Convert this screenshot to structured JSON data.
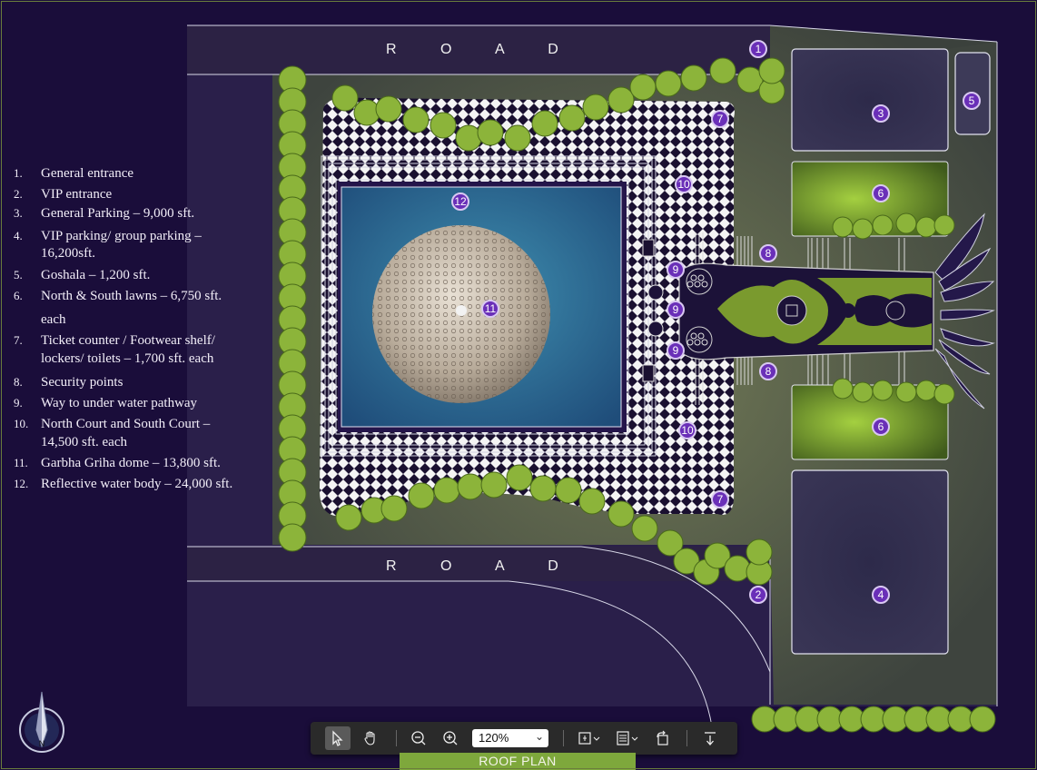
{
  "roads": {
    "top_label": "R O A D",
    "bottom_label": "R O A D"
  },
  "legend": [
    {
      "num": "1.",
      "text": "General entrance"
    },
    {
      "num": "2.",
      "text": "VIP entrance"
    },
    {
      "num": "3.",
      "text": "General Parking – 9,000 sft."
    },
    {
      "num": "4.",
      "text": "VIP parking/ group parking –",
      "text2": "16,200sft."
    },
    {
      "num": "5.",
      "text": "Goshala – 1,200 sft."
    },
    {
      "num": "6.",
      "text": "North & South lawns – 6,750 sft.",
      "text2": "each"
    },
    {
      "num": "7.",
      "text": "Ticket counter / Footwear shelf/",
      "text2": "lockers/ toilets – 1,700 sft. each"
    },
    {
      "num": "8.",
      "text": "Security points"
    },
    {
      "num": "9.",
      "text": "Way to under water pathway"
    },
    {
      "num": "10.",
      "text": "North Court and South Court –",
      "text2": "14,500 sft. each"
    },
    {
      "num": "11.",
      "text": "Garbha Griha dome – 13,800 sft."
    },
    {
      "num": "12.",
      "text": "Reflective water body – 24,000 sft."
    }
  ],
  "markers": {
    "m1": "1",
    "m2": "2",
    "m3": "3",
    "m4": "4",
    "m5": "5",
    "m6a": "6",
    "m6b": "6",
    "m7a": "7",
    "m7b": "7",
    "m8a": "8",
    "m8b": "8",
    "m9a": "9",
    "m9b": "9",
    "m9c": "9",
    "m10a": "10",
    "m10b": "10",
    "m11": "11",
    "m12": "12"
  },
  "compass": {
    "label": "N"
  },
  "toolbar": {
    "zoom_value": "120%",
    "icons": [
      "select-icon",
      "hand-icon",
      "zoom-out-icon",
      "zoom-in-icon",
      "page-fit-icon",
      "page-layout-icon",
      "rotate-icon",
      "export-icon"
    ]
  },
  "caption": "ROOF PLAN",
  "colors": {
    "background": "#1a0d3a",
    "marker": "#6a2fb8",
    "lawn": "#7a9a2e",
    "water": "#2e6f8e",
    "caption_bar": "#7ea83c"
  }
}
